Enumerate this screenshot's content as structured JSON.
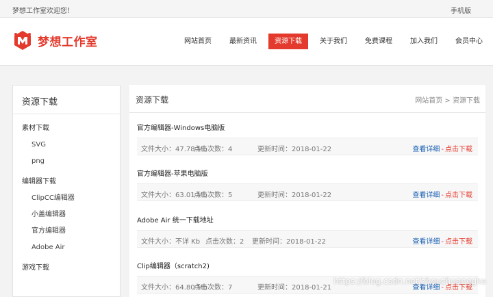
{
  "topbar": {
    "welcome": "梦想工作室欢迎您！",
    "mobile": "手机版"
  },
  "brand": {
    "name": "梦想工作室",
    "color": "#e43a2d"
  },
  "nav": [
    "网站首页",
    "最新资讯",
    "资源下载",
    "关于我们",
    "免费课程",
    "加入我们",
    "会员中心"
  ],
  "nav_active": "资源下载",
  "sidebar": {
    "title": "资源下载",
    "sections": [
      {
        "label": "素材下载",
        "items": [
          "SVG",
          "png"
        ]
      },
      {
        "label": "编辑器下载",
        "items": [
          "ClipCC编辑器",
          "小盖编辑器",
          "官方编辑器",
          "Adobe Air"
        ]
      },
      {
        "label": "游戏下载",
        "items": []
      }
    ]
  },
  "main": {
    "title": "资源下载",
    "breadcrumb": "网站首页 > 资源下载",
    "items": [
      {
        "title": "官方编辑器-Windows电脑版",
        "size": "文件大小：47.78 Mb",
        "clicks": "点击次数：4",
        "updated": "更新时间：2018-01-22",
        "detail": "查看详细",
        "download": "点击下载"
      },
      {
        "title": "官方编辑器-苹果电脑版",
        "size": "文件大小：63.01 Mb",
        "clicks": "点击次数：5",
        "updated": "更新时间：2018-01-22",
        "detail": "查看详细",
        "download": "点击下载"
      },
      {
        "title": "Adobe Air 统一下载地址",
        "size": "文件大小：不详 Kb",
        "clicks": "点击次数：2",
        "updated": "更新时间：2018-01-22",
        "detail": "查看详细",
        "download": "点击下载"
      },
      {
        "title": "Clip编辑器（scratch2)",
        "size": "文件大小：64.80 Mb",
        "clicks": "点击次数：7",
        "updated": "更新时间：2018-01-21",
        "detail": "查看详细",
        "download": "点击下载"
      }
    ]
  },
  "watermark": "https://blog.csdn.net/zhouzhuanggke"
}
